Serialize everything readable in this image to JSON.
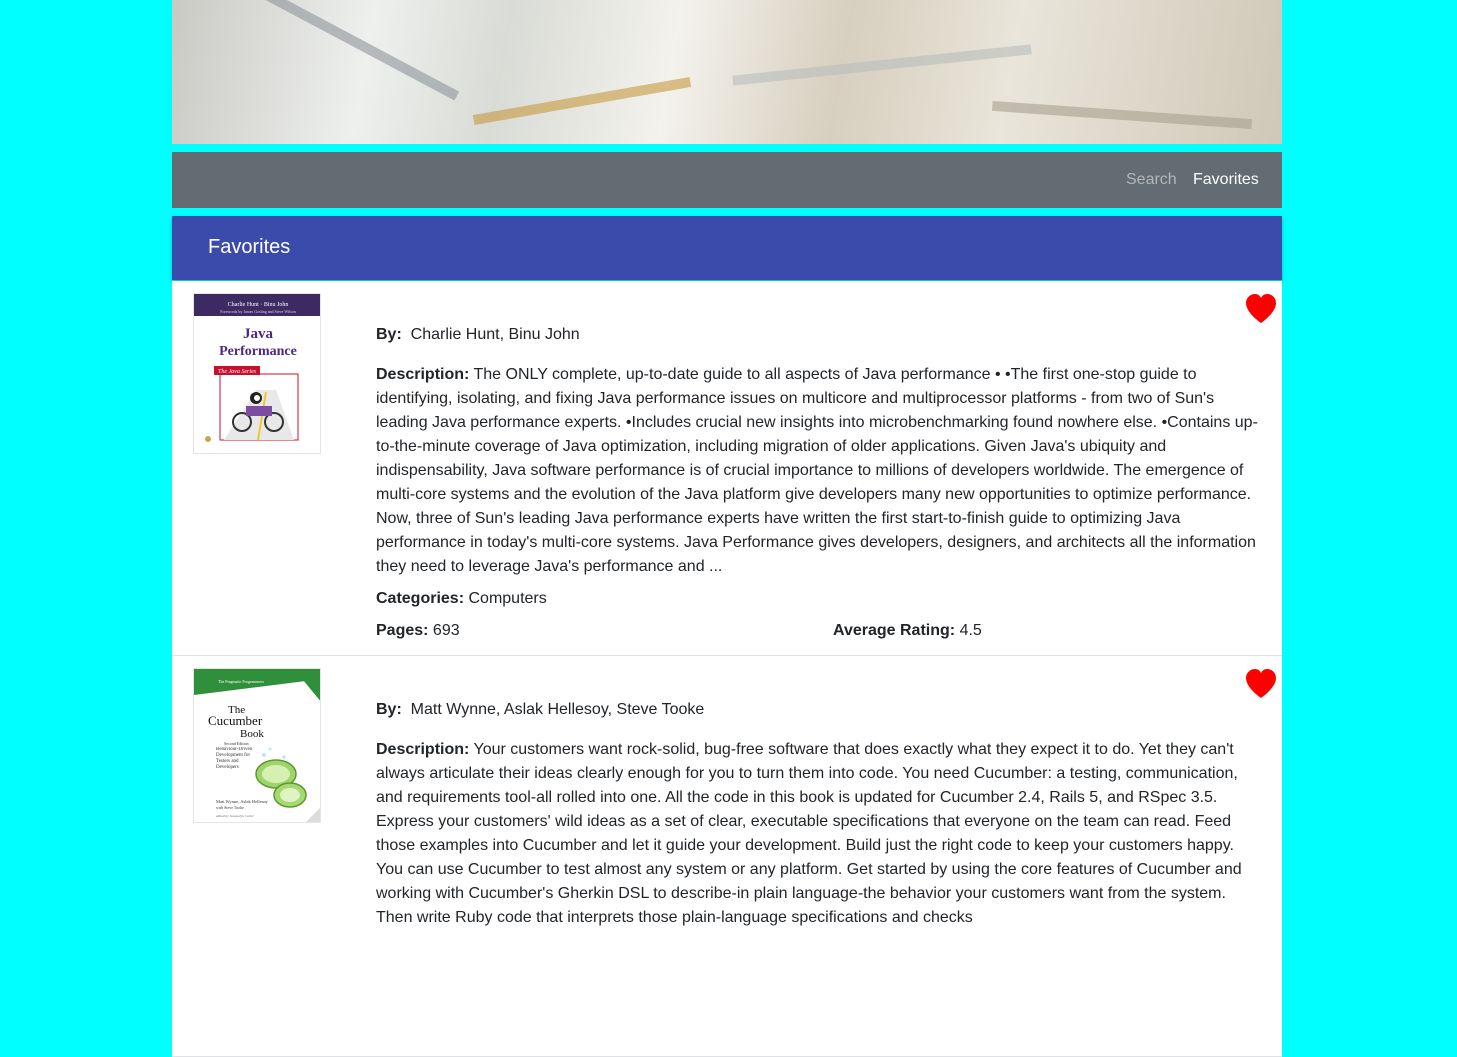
{
  "nav": {
    "search_label": "Search",
    "favorites_label": "Favorites"
  },
  "header": {
    "title": "Favorites"
  },
  "labels": {
    "by": "By:",
    "description": "Description:",
    "categories": "Categories:",
    "pages": "Pages:",
    "average_rating": "Average Rating:"
  },
  "books": [
    {
      "authors": "Charlie Hunt, Binu John",
      "description": "The ONLY complete, up-to-date guide to all aspects of Java performance • •The first one-stop guide to identifying, isolating, and fixing Java performance issues on multicore and multiprocessor platforms - from two of Sun's leading Java performance experts. •Includes crucial new insights into microbenchmarking found nowhere else. •Contains up-to-the-minute coverage of Java optimization, including migration of older applications. Given Java's ubiquity and indispensability, Java software performance is of crucial importance to millions of developers worldwide. The emergence of multi-core systems and the evolution of the Java platform give developers many new opportunities to optimize performance. Now, three of Sun's leading Java performance experts have written the first start-to-finish guide to optimizing Java performance in today's multi-core systems. Java Performance gives developers, designers, and architects all the information they need to leverage Java's performance and ...",
      "categories": "Computers",
      "pages": "693",
      "average_rating": "4.5",
      "cover": {
        "authors_line": "Charlie Hunt · Binu John",
        "forewords_line": "Forewords by James Gosling and Steve Wilson",
        "title_line1": "Java",
        "title_line2": "Performance",
        "series": "The Java Series"
      }
    },
    {
      "authors": "Matt Wynne, Aslak Hellesoy, Steve Tooke",
      "description": "Your customers want rock-solid, bug-free software that does exactly what they expect it to do. Yet they can't always articulate their ideas clearly enough for you to turn them into code. You need Cucumber: a testing, communication, and requirements tool-all rolled into one. All the code in this book is updated for Cucumber 2.4, Rails 5, and RSpec 3.5. Express your customers' wild ideas as a set of clear, executable specifications that everyone on the team can read. Feed those examples into Cucumber and let it guide your development. Build just the right code to keep your customers happy. You can use Cucumber to test almost any system or any platform. Get started by using the core features of Cucumber and working with Cucumber's Gherkin DSL to describe-in plain language-the behavior your customers want from the system. Then write Ruby code that interprets those plain-language specifications and checks",
      "cover": {
        "publisher": "The Pragmatic Programmers",
        "title_line1": "The",
        "title_line2": "Cucumber",
        "title_line3": "Book",
        "edition": "Second Edition",
        "subtitle": "Behaviour-Driven Development for Testers and Developers",
        "authors_line": "Matt Wynne, Aslak Hellesøy",
        "with_line": "with Steve Tooke",
        "editor_line": "edited by Jacquelyn Carter"
      }
    }
  ],
  "colors": {
    "page_background": "#00ffff",
    "navbar": "#636c72",
    "header_bar": "#3b4bab",
    "heart": "#ff0000"
  }
}
